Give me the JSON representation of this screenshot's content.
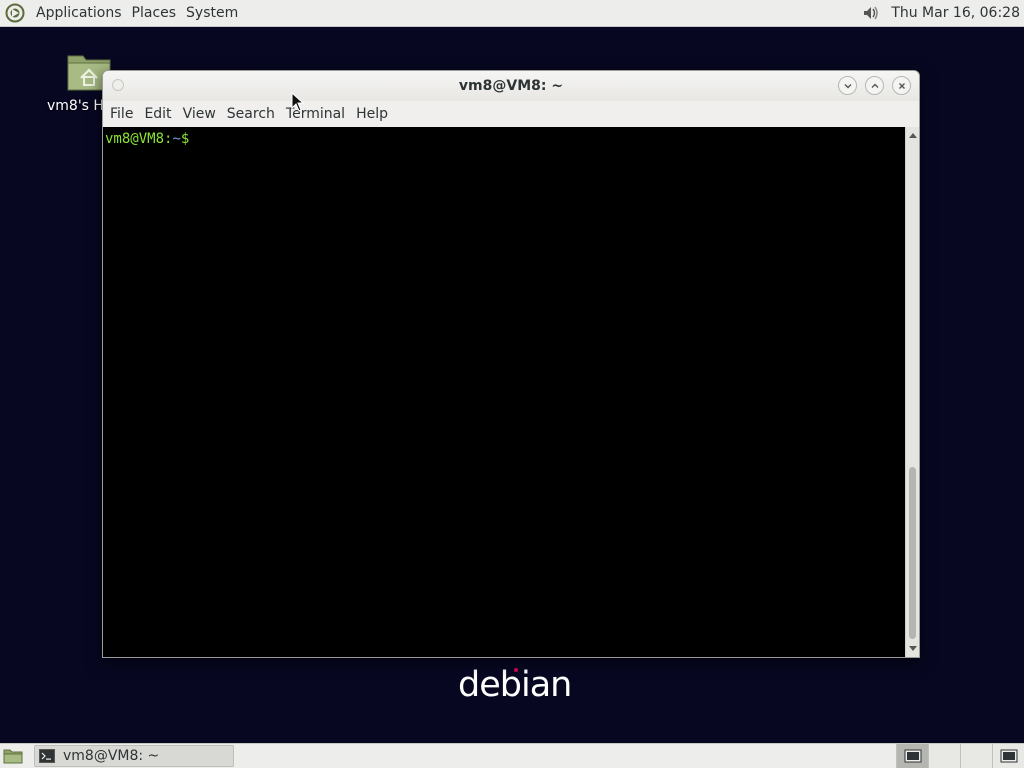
{
  "top_panel": {
    "logo_icon": "gnome-foot-icon",
    "menus": [
      "Applications",
      "Places",
      "System"
    ],
    "volume_icon": "speaker-volume-icon",
    "clock": "Thu Mar 16, 06:28"
  },
  "desktop": {
    "background_color": "#070722",
    "home_icon": {
      "icon": "home-folder-icon",
      "label": "vm8's H"
    },
    "watermark": "debian"
  },
  "terminal": {
    "title": "vm8@VM8: ~",
    "menubar": [
      "File",
      "Edit",
      "View",
      "Search",
      "Terminal",
      "Help"
    ],
    "prompt": {
      "user_host": "vm8@VM8",
      "separator": ":",
      "path": "~",
      "symbol": "$"
    },
    "colors": {
      "background": "#000000",
      "user": "#8ae234",
      "path": "#729fcf"
    }
  },
  "bottom_panel": {
    "show_desktop_icon": "show-desktop-icon",
    "task": {
      "icon": "terminal-icon",
      "label": "vm8@VM8: ~"
    },
    "workspaces": 4,
    "active_workspace": 1
  }
}
